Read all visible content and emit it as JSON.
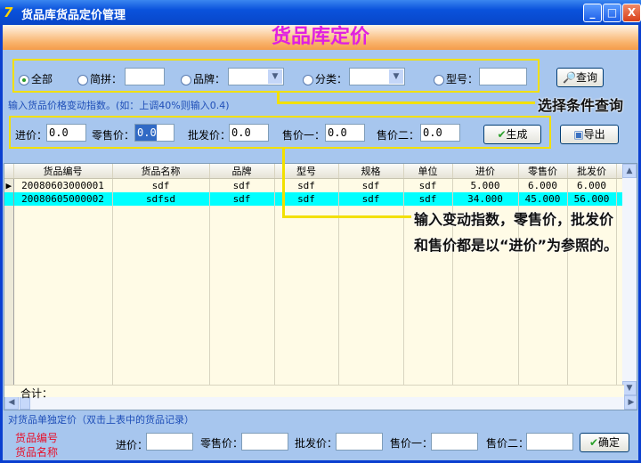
{
  "window": {
    "title": "货品库货品定价管理",
    "logo": "7",
    "minimize": "_",
    "maximize": "□",
    "close": "X"
  },
  "banner": {
    "title": "货品库定价"
  },
  "filter": {
    "options": [
      {
        "label": "全部",
        "selected": true
      },
      {
        "label": "简拼："
      },
      {
        "label": "品牌："
      },
      {
        "label": "分类："
      },
      {
        "label": "型号："
      }
    ],
    "query_button": "查询"
  },
  "hint": "输入货品价格变动指数。(如：上调40%则输入0.4)",
  "index": {
    "fields": [
      {
        "label": "进价：",
        "value": "0.0"
      },
      {
        "label": "零售价：",
        "value": "0.0"
      },
      {
        "label": "批发价：",
        "value": "0.0"
      },
      {
        "label": "售价一：",
        "value": "0.0"
      },
      {
        "label": "售价二：",
        "value": "0.0"
      }
    ],
    "generate_button": "生成",
    "export_button": "导出"
  },
  "callouts": {
    "query": "选择条件查询",
    "index_line1": "输入变动指数，零售价，批发价",
    "index_line2": "和售价都是以“进价”为参照的。"
  },
  "table": {
    "columns": [
      "货品编号",
      "货品名称",
      "品牌",
      "型号",
      "规格",
      "单位",
      "进价",
      "零售价",
      "批发价"
    ],
    "rows": [
      [
        "20080603000001",
        "sdf",
        "sdf",
        "sdf",
        "sdf",
        "sdf",
        "5.000",
        "6.000",
        "6.000"
      ],
      [
        "20080605000002",
        "sdfsd",
        "sdf",
        "sdf",
        "sdf",
        "sdf",
        "34.000",
        "45.000",
        "56.000"
      ]
    ],
    "selected_row": 1,
    "total_label": "合计："
  },
  "single": {
    "title": "对货品单独定价（双击上表中的货品记录）",
    "code_label": "货品编号",
    "name_label": "货品名称",
    "fields": [
      {
        "label": "进价："
      },
      {
        "label": "零售价："
      },
      {
        "label": "批发价："
      },
      {
        "label": "售价一："
      },
      {
        "label": "售价二："
      }
    ],
    "confirm_button": "确定"
  }
}
